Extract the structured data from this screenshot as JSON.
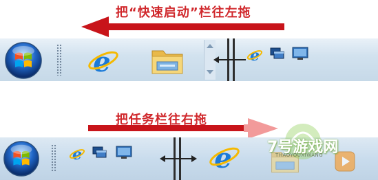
{
  "top_caption": "把“快速启动”栏往左拖",
  "bottom_caption": "把任务栏往右拖",
  "watermark": {
    "logo_text": "7号游戏网",
    "sub_text": "THAOYOUXIWANG"
  },
  "colors": {
    "caption_red": "#d0282c",
    "arrow_red": "#c8141a",
    "arrow_light": "#f29a9a",
    "taskbar_top": "#e9f1f8",
    "taskbar_bottom": "#c6d9e8"
  },
  "top_taskbar": {
    "items": [
      "start-orb-icon",
      "internet-explorer-icon",
      "windows-explorer-icon",
      "internet-explorer-icon",
      "switch-windows-icon",
      "show-desktop-icon"
    ]
  },
  "bottom_taskbar": {
    "items": [
      "start-orb-icon",
      "internet-explorer-icon",
      "switch-windows-icon",
      "show-desktop-icon",
      "internet-explorer-icon",
      "windows-explorer-icon",
      "media-player-icon"
    ]
  }
}
